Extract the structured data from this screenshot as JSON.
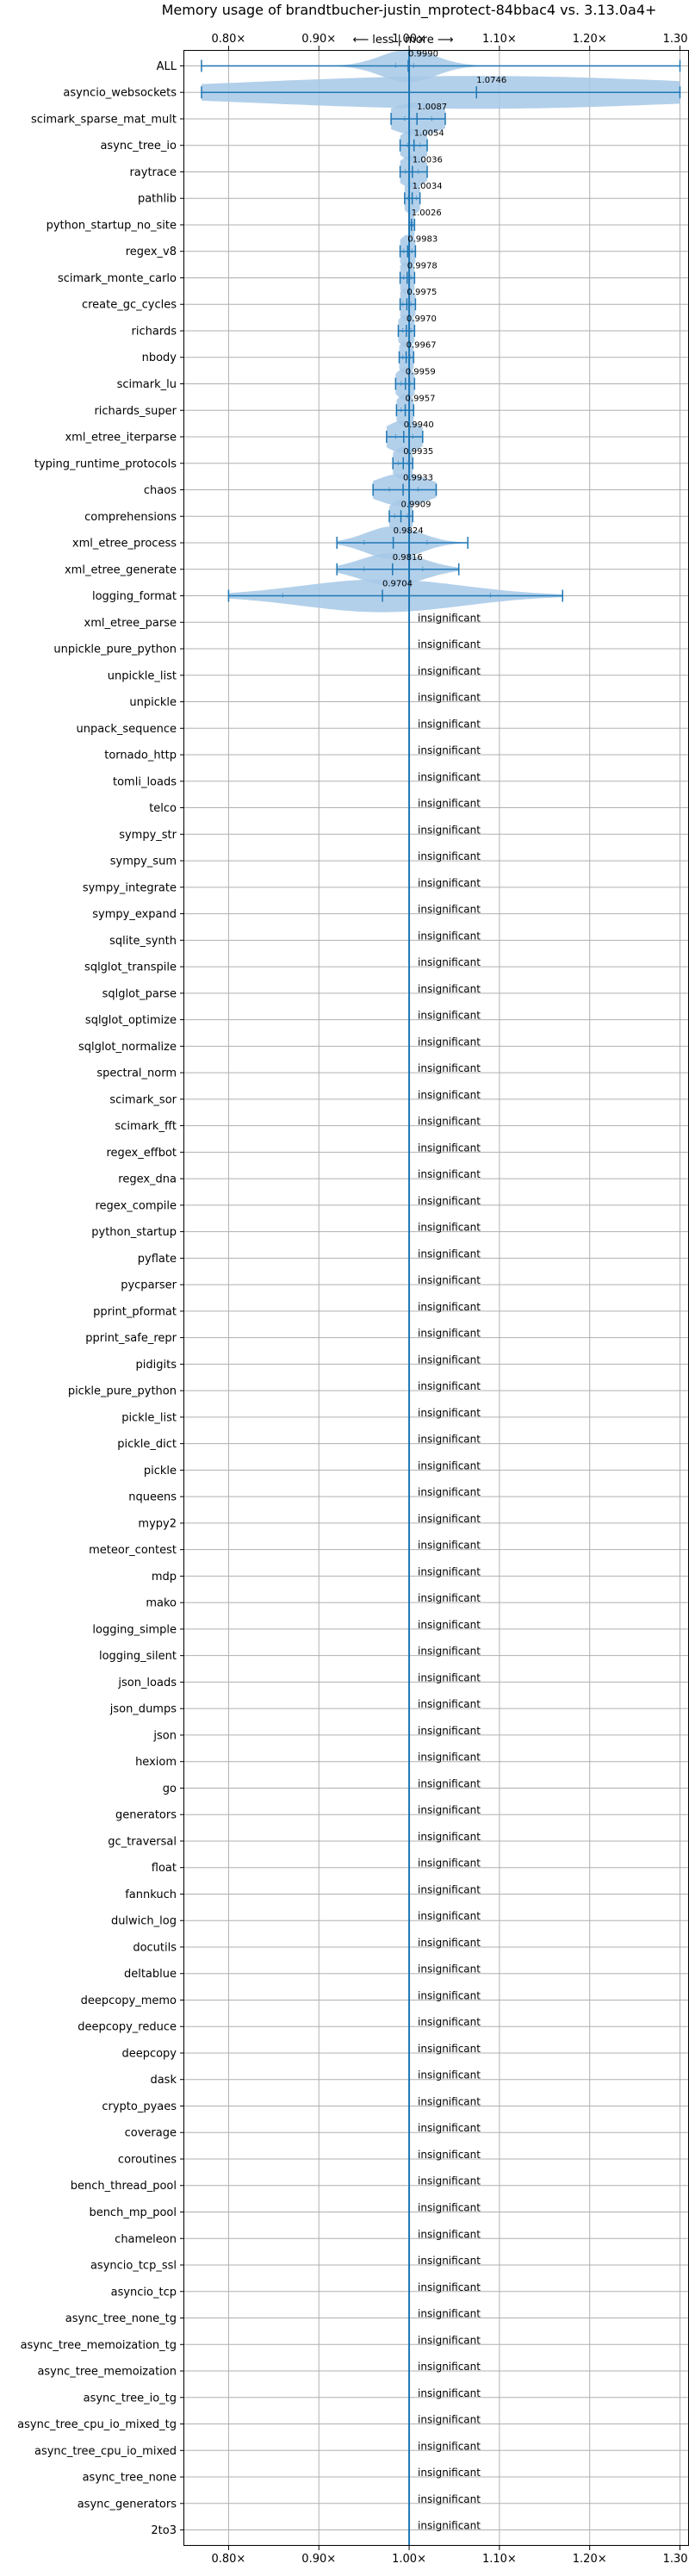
{
  "colors": {
    "accent": "#1f77b4",
    "violin": "#a6c8e6",
    "grid": "#b0b0b0",
    "axis": "#000000"
  },
  "chart_data": {
    "type": "violin",
    "title": "Memory usage of brandtbucher-justin_mprotect-84bbac4 vs. 3.13.0a4+",
    "direction_label": "⟵ less | more ⟶",
    "insignificant_label": "insignificant",
    "xlim": [
      0.75,
      1.31
    ],
    "xticks": [
      0.8,
      0.9,
      1.0,
      1.1,
      1.2,
      1.3
    ],
    "xtick_labels": [
      "0.80×",
      "0.90×",
      "1.00×",
      "1.10×",
      "1.20×",
      "1.30×"
    ],
    "grid": true,
    "reference_line": 1.0,
    "benchmarks": [
      {
        "name": "ALL",
        "value": 0.999,
        "label": "0.9990",
        "min": 0.77,
        "max": 1.3,
        "spread": 0.03,
        "q1": 0.985,
        "q3": 1.005
      },
      {
        "name": "asyncio_websockets",
        "value": 1.0746,
        "label": "1.0746",
        "min": 0.77,
        "max": 1.3,
        "spread": 0.26,
        "q1": 0.77,
        "q3": 1.3
      },
      {
        "name": "scimark_sparse_mat_mult",
        "value": 1.0087,
        "label": "1.0087",
        "min": 0.98,
        "max": 1.04,
        "spread": 0.03,
        "q1": 0.995,
        "q3": 1.025
      },
      {
        "name": "async_tree_io",
        "value": 1.0054,
        "label": "1.0054",
        "min": 0.99,
        "max": 1.02,
        "spread": 0.015,
        "q1": 0.998,
        "q3": 1.012
      },
      {
        "name": "raytrace",
        "value": 1.0036,
        "label": "1.0036",
        "min": 0.99,
        "max": 1.02,
        "spread": 0.015,
        "q1": 0.996,
        "q3": 1.01
      },
      {
        "name": "pathlib",
        "value": 1.0034,
        "label": "1.0034",
        "min": 0.995,
        "max": 1.012,
        "spread": 0.01,
        "q1": 0.999,
        "q3": 1.008
      },
      {
        "name": "python_startup_no_site",
        "value": 1.0026,
        "label": "1.0026",
        "min": 1.0,
        "max": 1.006,
        "spread": 0.004,
        "q1": 1.001,
        "q3": 1.004
      },
      {
        "name": "regex_v8",
        "value": 0.9983,
        "label": "0.9983",
        "min": 0.99,
        "max": 1.007,
        "spread": 0.01,
        "q1": 0.994,
        "q3": 1.003
      },
      {
        "name": "scimark_monte_carlo",
        "value": 0.9978,
        "label": "0.9978",
        "min": 0.99,
        "max": 1.006,
        "spread": 0.01,
        "q1": 0.994,
        "q3": 1.002
      },
      {
        "name": "create_gc_cycles",
        "value": 0.9975,
        "label": "0.9975",
        "min": 0.99,
        "max": 1.007,
        "spread": 0.01,
        "q1": 0.993,
        "q3": 1.002
      },
      {
        "name": "richards",
        "value": 0.997,
        "label": "0.9970",
        "min": 0.988,
        "max": 1.006,
        "spread": 0.01,
        "q1": 0.993,
        "q3": 1.002
      },
      {
        "name": "nbody",
        "value": 0.9967,
        "label": "0.9967",
        "min": 0.989,
        "max": 1.005,
        "spread": 0.009,
        "q1": 0.993,
        "q3": 1.001
      },
      {
        "name": "scimark_lu",
        "value": 0.9959,
        "label": "0.9959",
        "min": 0.985,
        "max": 1.006,
        "spread": 0.011,
        "q1": 0.991,
        "q3": 1.001
      },
      {
        "name": "richards_super",
        "value": 0.9957,
        "label": "0.9957",
        "min": 0.986,
        "max": 1.005,
        "spread": 0.01,
        "q1": 0.991,
        "q3": 1.0
      },
      {
        "name": "xml_etree_iterparse",
        "value": 0.994,
        "label": "0.9940",
        "min": 0.975,
        "max": 1.015,
        "spread": 0.02,
        "q1": 0.985,
        "q3": 1.004
      },
      {
        "name": "typing_runtime_protocols",
        "value": 0.9935,
        "label": "0.9935",
        "min": 0.982,
        "max": 1.004,
        "spread": 0.012,
        "q1": 0.988,
        "q3": 0.999
      },
      {
        "name": "chaos",
        "value": 0.9933,
        "label": "0.9933",
        "min": 0.96,
        "max": 1.03,
        "spread": 0.03,
        "q1": 0.978,
        "q3": 1.01
      },
      {
        "name": "comprehensions",
        "value": 0.9909,
        "label": "0.9909",
        "min": 0.978,
        "max": 1.004,
        "spread": 0.013,
        "q1": 0.984,
        "q3": 0.998
      },
      {
        "name": "xml_etree_process",
        "value": 0.9824,
        "label": "0.9824",
        "min": 0.92,
        "max": 1.065,
        "spread": 0.03,
        "q1": 0.95,
        "q3": 1.02
      },
      {
        "name": "xml_etree_generate",
        "value": 0.9816,
        "label": "0.9816",
        "min": 0.92,
        "max": 1.055,
        "spread": 0.035,
        "q1": 0.95,
        "q3": 1.015
      },
      {
        "name": "logging_format",
        "value": 0.9704,
        "label": "0.9704",
        "min": 0.8,
        "max": 1.17,
        "spread": 0.09,
        "q1": 0.86,
        "q3": 1.09
      },
      {
        "name": "xml_etree_parse"
      },
      {
        "name": "unpickle_pure_python"
      },
      {
        "name": "unpickle_list"
      },
      {
        "name": "unpickle"
      },
      {
        "name": "unpack_sequence"
      },
      {
        "name": "tornado_http"
      },
      {
        "name": "tomli_loads"
      },
      {
        "name": "telco"
      },
      {
        "name": "sympy_str"
      },
      {
        "name": "sympy_sum"
      },
      {
        "name": "sympy_integrate"
      },
      {
        "name": "sympy_expand"
      },
      {
        "name": "sqlite_synth"
      },
      {
        "name": "sqlglot_transpile"
      },
      {
        "name": "sqlglot_parse"
      },
      {
        "name": "sqlglot_optimize"
      },
      {
        "name": "sqlglot_normalize"
      },
      {
        "name": "spectral_norm"
      },
      {
        "name": "scimark_sor"
      },
      {
        "name": "scimark_fft"
      },
      {
        "name": "regex_effbot"
      },
      {
        "name": "regex_dna"
      },
      {
        "name": "regex_compile"
      },
      {
        "name": "python_startup"
      },
      {
        "name": "pyflate"
      },
      {
        "name": "pycparser"
      },
      {
        "name": "pprint_pformat"
      },
      {
        "name": "pprint_safe_repr"
      },
      {
        "name": "pidigits"
      },
      {
        "name": "pickle_pure_python"
      },
      {
        "name": "pickle_list"
      },
      {
        "name": "pickle_dict"
      },
      {
        "name": "pickle"
      },
      {
        "name": "nqueens"
      },
      {
        "name": "mypy2"
      },
      {
        "name": "meteor_contest"
      },
      {
        "name": "mdp"
      },
      {
        "name": "mako"
      },
      {
        "name": "logging_simple"
      },
      {
        "name": "logging_silent"
      },
      {
        "name": "json_loads"
      },
      {
        "name": "json_dumps"
      },
      {
        "name": "json"
      },
      {
        "name": "hexiom"
      },
      {
        "name": "go"
      },
      {
        "name": "generators"
      },
      {
        "name": "gc_traversal"
      },
      {
        "name": "float"
      },
      {
        "name": "fannkuch"
      },
      {
        "name": "dulwich_log"
      },
      {
        "name": "docutils"
      },
      {
        "name": "deltablue"
      },
      {
        "name": "deepcopy_memo"
      },
      {
        "name": "deepcopy_reduce"
      },
      {
        "name": "deepcopy"
      },
      {
        "name": "dask"
      },
      {
        "name": "crypto_pyaes"
      },
      {
        "name": "coverage"
      },
      {
        "name": "coroutines"
      },
      {
        "name": "bench_thread_pool"
      },
      {
        "name": "bench_mp_pool"
      },
      {
        "name": "chameleon"
      },
      {
        "name": "asyncio_tcp_ssl"
      },
      {
        "name": "asyncio_tcp"
      },
      {
        "name": "async_tree_none_tg"
      },
      {
        "name": "async_tree_memoization_tg"
      },
      {
        "name": "async_tree_memoization"
      },
      {
        "name": "async_tree_io_tg"
      },
      {
        "name": "async_tree_cpu_io_mixed_tg"
      },
      {
        "name": "async_tree_cpu_io_mixed"
      },
      {
        "name": "async_tree_none"
      },
      {
        "name": "async_generators"
      },
      {
        "name": "2to3"
      }
    ]
  }
}
